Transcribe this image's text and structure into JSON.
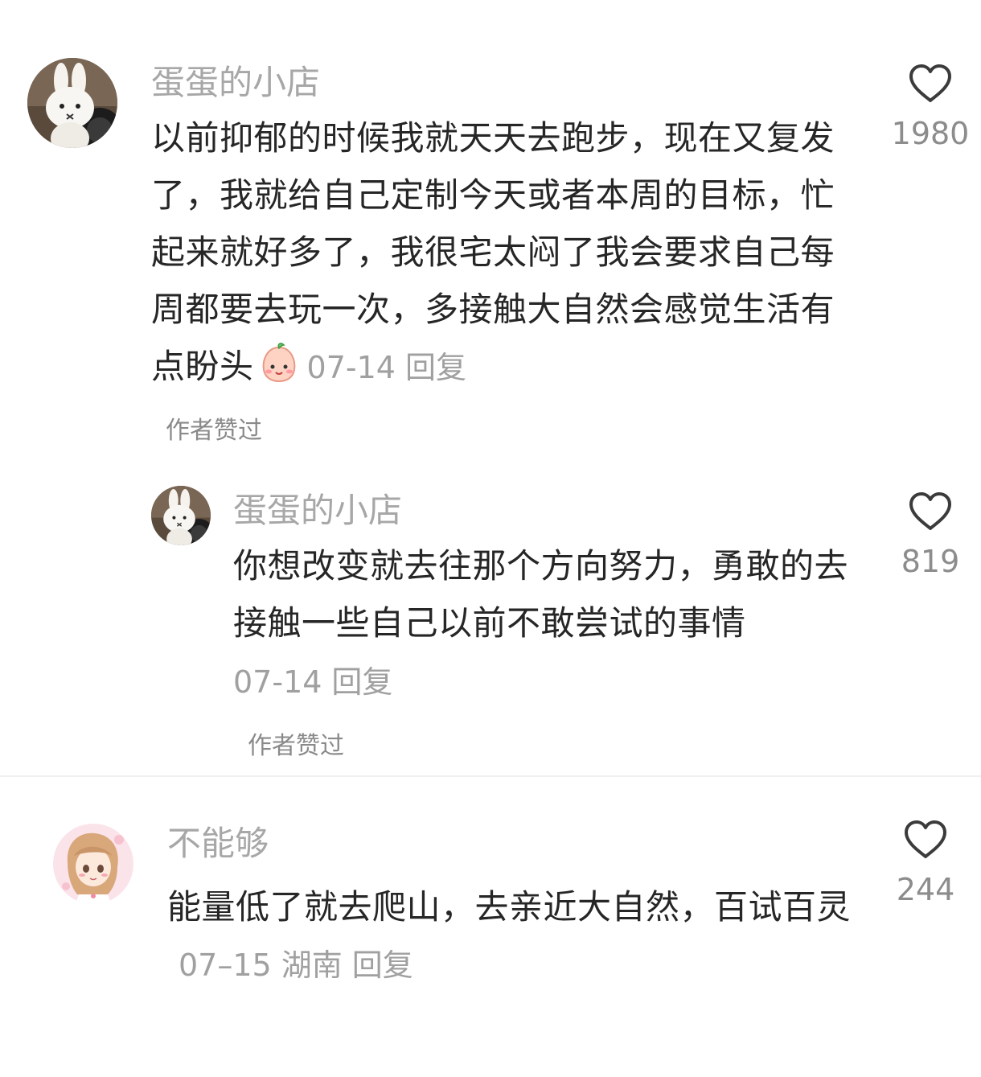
{
  "comments": [
    {
      "username": "蛋蛋的小店",
      "text": "以前抑郁的时候我就天天去跑步，现在又复发了，我就给自己定制今天或者本周的目标，忙起来就好多了，我很宅太闷了我会要求自己每周都要去玩一次，多接触大自然会感觉生活有点盼头",
      "date": "07-14",
      "reply_label": "回复",
      "likes": "1980",
      "author_liked": "作者赞过",
      "avatar_icon": "bunny-avatar",
      "emoji_icon": "peach-emoji"
    },
    {
      "username": "蛋蛋的小店",
      "text": "你想改变就去往那个方向努力，勇敢的去接触一些自己以前不敢尝试的事情",
      "date": "07-14",
      "reply_label": "回复",
      "likes": "819",
      "author_liked": "作者赞过",
      "avatar_icon": "bunny-avatar"
    },
    {
      "username": "不能够",
      "text": "能量低了就去爬山，去亲近大自然，百试百灵",
      "date": "07–15",
      "location": "湖南",
      "reply_label": "回复",
      "likes": "244",
      "avatar_icon": "anime-girl-avatar"
    }
  ],
  "colors": {
    "username": "#a7a7a7",
    "text": "#262626",
    "meta": "#a0a0a0",
    "divider": "#f0f0f0"
  },
  "icons": {
    "like": "heart-outline-icon"
  }
}
